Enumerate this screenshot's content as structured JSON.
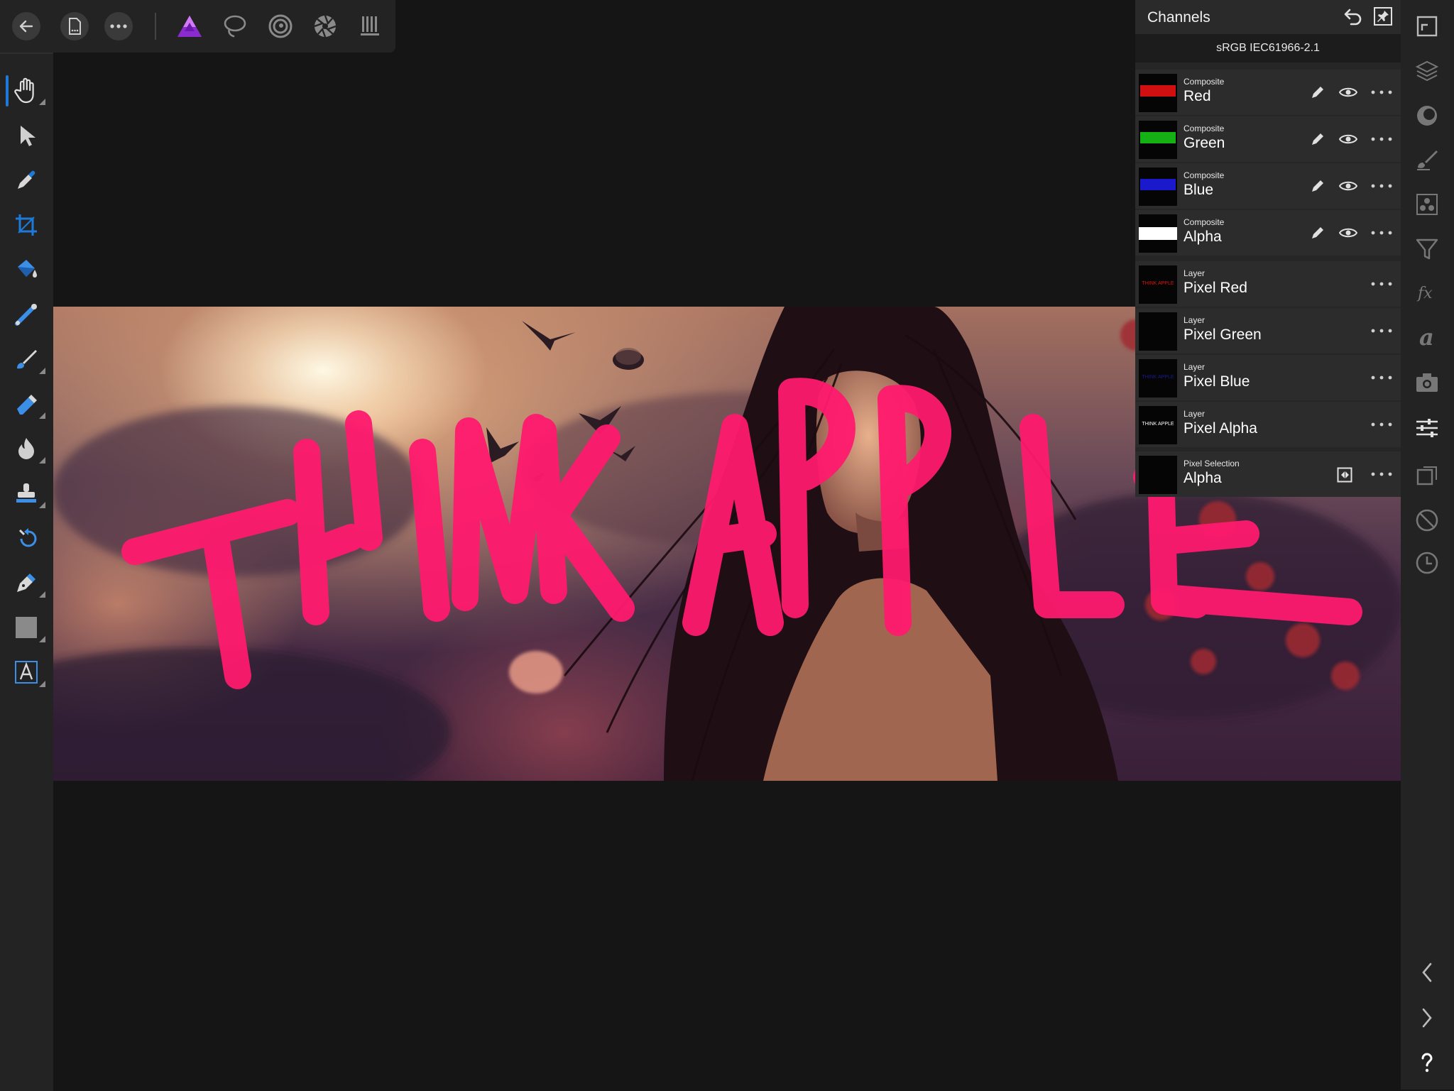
{
  "channels_panel": {
    "title": "Channels",
    "color_profile": "sRGB IEC61966-2.1",
    "composite_rows": [
      {
        "category": "Composite",
        "name": "Red",
        "thumb_color": "#e01010"
      },
      {
        "category": "Composite",
        "name": "Green",
        "thumb_color": "#18c018"
      },
      {
        "category": "Composite",
        "name": "Blue",
        "thumb_color": "#2020e0"
      },
      {
        "category": "Composite",
        "name": "Alpha",
        "thumb_color": "#ffffff"
      }
    ],
    "layer_rows": [
      {
        "category": "Layer",
        "name": "Pixel Red",
        "thumb_text": "THINK APPLE",
        "thumb_color": "#e01010"
      },
      {
        "category": "Layer",
        "name": "Pixel Green",
        "thumb_text": "",
        "thumb_color": "#0a0a0a"
      },
      {
        "category": "Layer",
        "name": "Pixel Blue",
        "thumb_text": "THINK APPLE",
        "thumb_color": "#1010a0"
      },
      {
        "category": "Layer",
        "name": "Pixel Alpha",
        "thumb_text": "THINK APPLE",
        "thumb_color": "#ffffff"
      }
    ],
    "selection_row": {
      "category": "Pixel Selection",
      "name": "Alpha"
    }
  },
  "canvas": {
    "overlay_text": "THINK APPLE",
    "overlay_color": "#ff1a6e"
  },
  "colors": {
    "accent": "#1e7ad9",
    "app_bg": "#151515",
    "panel_bg": "#262626",
    "affinity_logo": "#b045e8"
  },
  "icons": {
    "top_toolbar": [
      "back-arrow-icon",
      "document-icon",
      "more-icon",
      "affinity-photo-persona-icon",
      "lasso-persona-icon",
      "liquify-persona-icon",
      "develop-persona-icon",
      "tone-mapping-persona-icon"
    ],
    "left_tools": [
      "hand-tool-icon",
      "move-tool-icon",
      "color-picker-icon",
      "crop-tool-icon",
      "flood-fill-icon",
      "gradient-tool-icon",
      "paint-brush-icon",
      "erase-brush-icon",
      "burn-brush-icon",
      "clone-stamp-icon",
      "undo-brush-icon",
      "pen-tool-icon",
      "rectangle-tool-icon",
      "text-tool-icon"
    ],
    "right_studio": [
      "navigator-icon",
      "layers-icon",
      "channels-icon",
      "brushes-icon",
      "swatches-icon",
      "filters-icon",
      "fx-icon",
      "text-styles-icon",
      "snapshots-icon",
      "adjustments-icon",
      "transform-icon",
      "stock-icon",
      "history-icon",
      "collapse-left-icon",
      "expand-right-icon",
      "help-icon"
    ]
  }
}
